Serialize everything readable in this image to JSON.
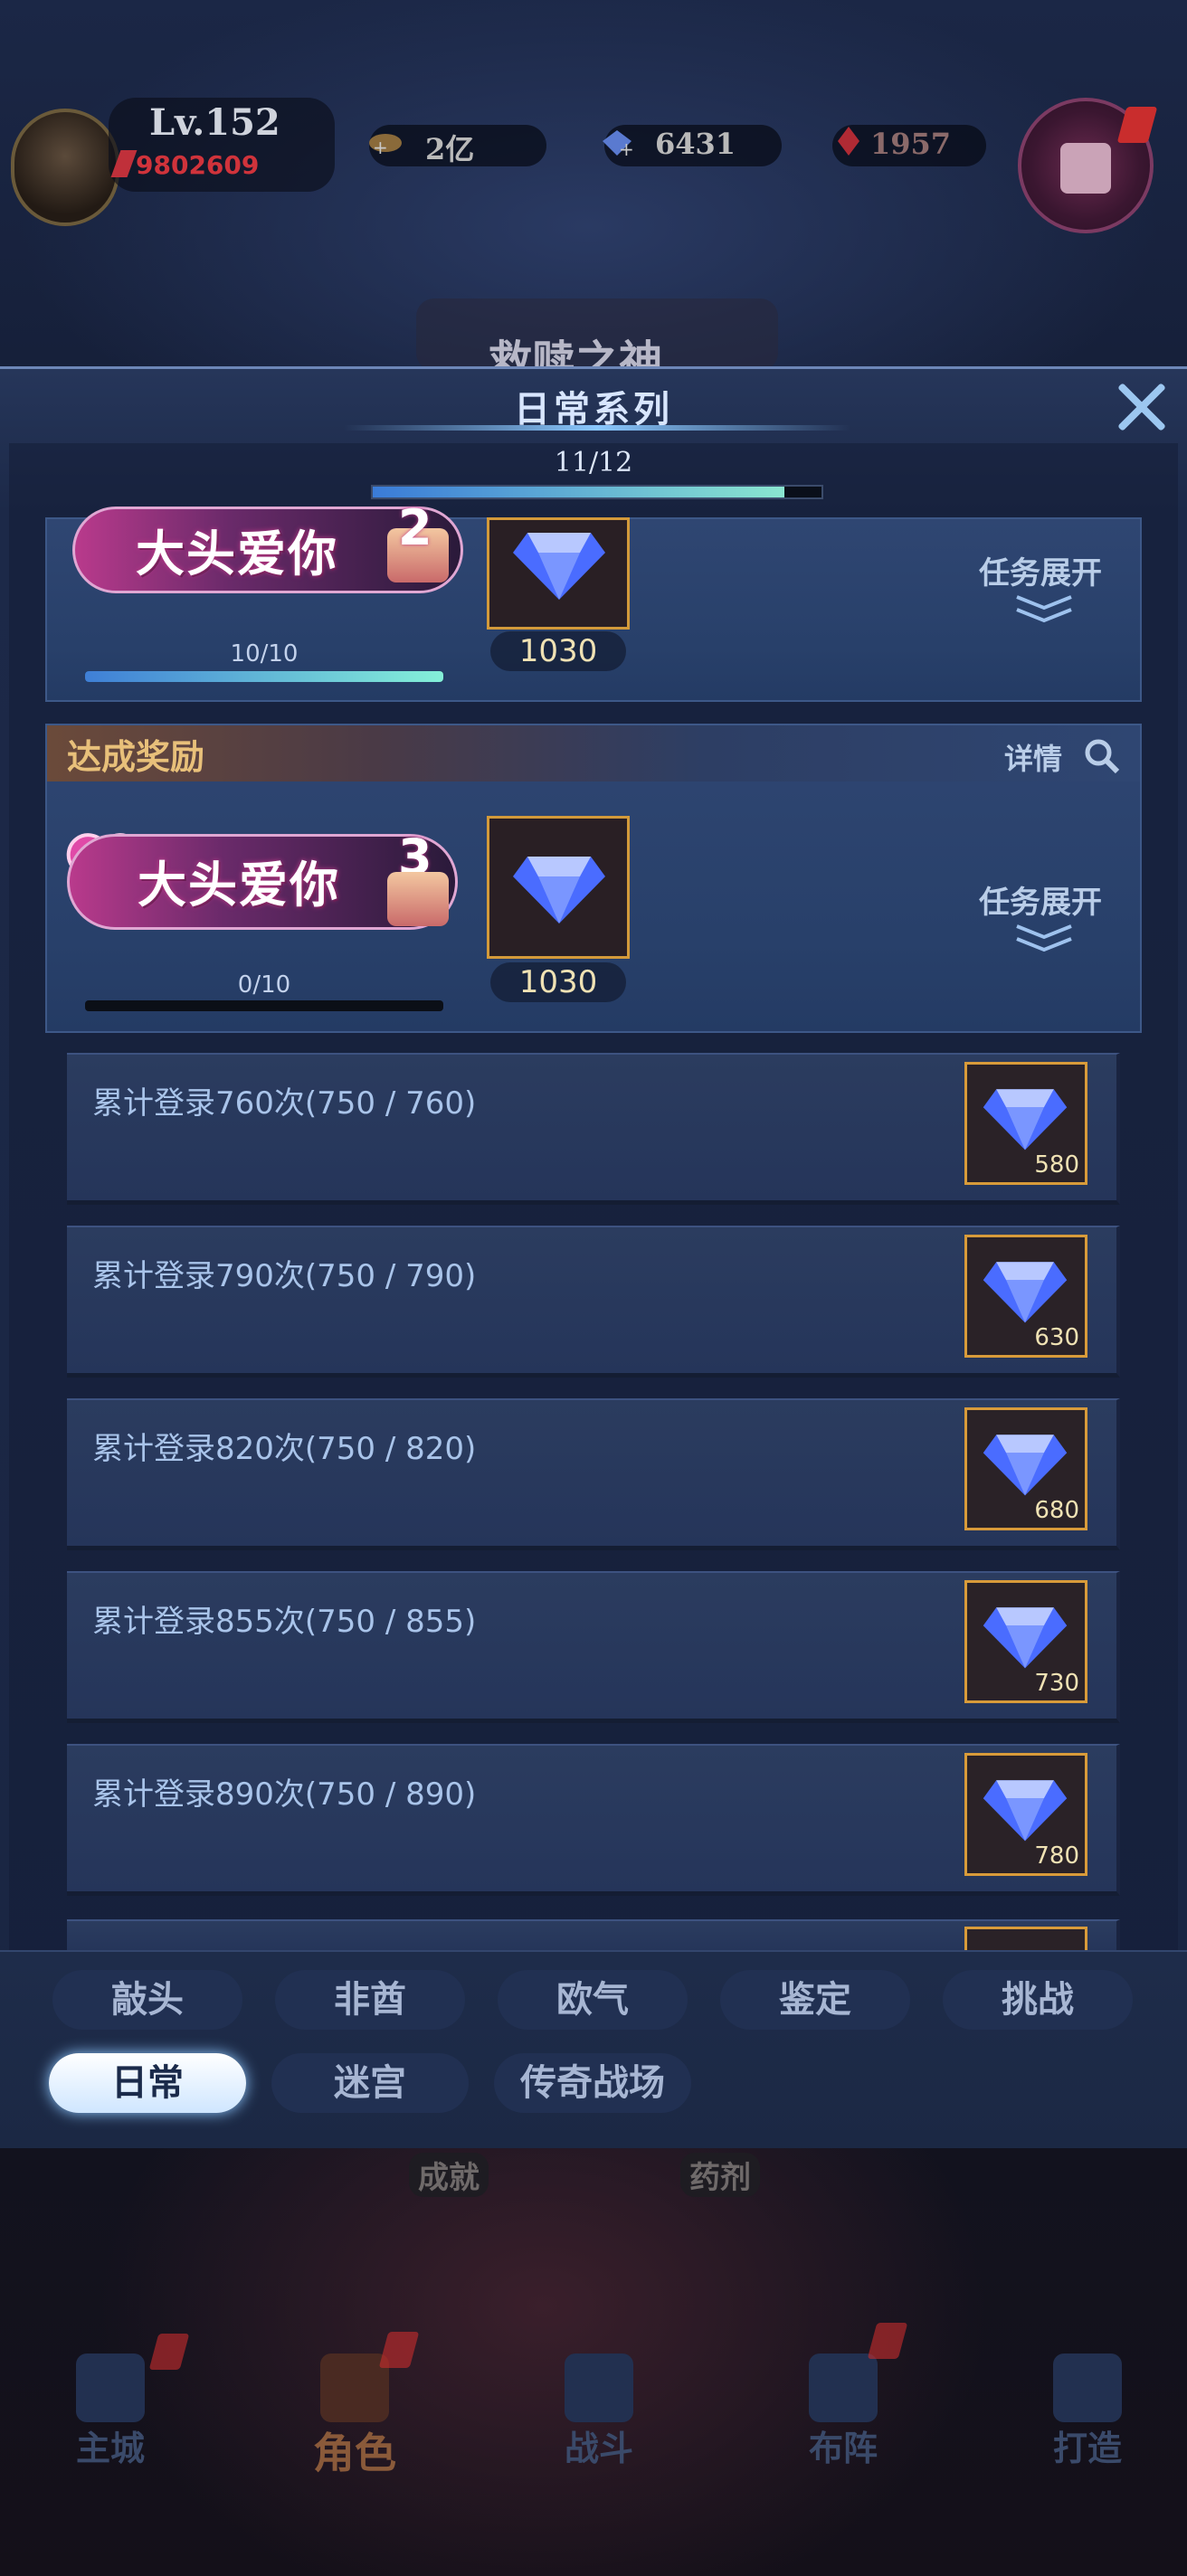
{
  "hud": {
    "level": "Lv.152",
    "power": "9802609",
    "gold": "2亿",
    "crystal": "6431",
    "ruby": "1957",
    "banner_title": "救赎之神"
  },
  "dialog": {
    "title": "日常系列",
    "progress_label": "11/12",
    "progress": 0.917,
    "close_icon": "close-icon"
  },
  "cards": [
    {
      "banner": "大头爱你",
      "badge": "2",
      "reward": "1030",
      "progress_label": "10/10",
      "progress": 1.0,
      "expand_label": "任务展开"
    },
    {
      "header": "达成奖励",
      "detail": "详情",
      "banner": "大头爱你",
      "badge": "3",
      "reward": "1030",
      "progress_label": "0/10",
      "progress": 0.0,
      "expand_label": "任务展开"
    }
  ],
  "tasks": [
    {
      "text": "累计登录760次(750 / 760)",
      "reward": "580"
    },
    {
      "text": "累计登录790次(750 / 790)",
      "reward": "630"
    },
    {
      "text": "累计登录820次(750 / 820)",
      "reward": "680"
    },
    {
      "text": "累计登录855次(750 / 855)",
      "reward": "730"
    },
    {
      "text": "累计登录890次(750 / 890)",
      "reward": "780"
    }
  ],
  "tabs_row1": [
    "敲头",
    "非酋",
    "欧气",
    "鉴定",
    "挑战"
  ],
  "tabs_row2": [
    "日常",
    "迷宫",
    "传奇战场"
  ],
  "active_tab": "日常",
  "under_labels": [
    "成就",
    "药剂"
  ],
  "bottom_nav": [
    "主城",
    "角色",
    "战斗",
    "布阵",
    "打造"
  ],
  "colors": {
    "accent": "#8ec8ff",
    "gold_border": "#d39a3a",
    "header_gold": "#e8c07a"
  }
}
